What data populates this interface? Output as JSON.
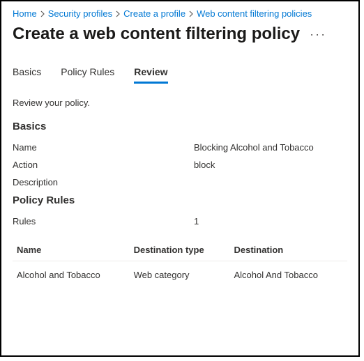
{
  "breadcrumb": {
    "items": [
      {
        "label": "Home"
      },
      {
        "label": "Security profiles"
      },
      {
        "label": "Create a profile"
      },
      {
        "label": "Web content filtering policies"
      }
    ]
  },
  "page": {
    "title": "Create a web content filtering policy",
    "more_label": "···"
  },
  "tabs": {
    "items": [
      {
        "label": "Basics",
        "active": false
      },
      {
        "label": "Policy Rules",
        "active": false
      },
      {
        "label": "Review",
        "active": true
      }
    ]
  },
  "review": {
    "intro": "Review your policy.",
    "basics_heading": "Basics",
    "basics": {
      "name_label": "Name",
      "name_value": "Blocking Alcohol and Tobacco",
      "action_label": "Action",
      "action_value": "block",
      "description_label": "Description",
      "description_value": ""
    },
    "rules_heading": "Policy Rules",
    "rules_count_label": "Rules",
    "rules_count_value": "1",
    "rules_table": {
      "headers": {
        "name": "Name",
        "dest_type": "Destination type",
        "destination": "Destination"
      },
      "rows": [
        {
          "name": "Alcohol and Tobacco",
          "dest_type": "Web category",
          "destination": "Alcohol And Tobacco"
        }
      ]
    }
  }
}
